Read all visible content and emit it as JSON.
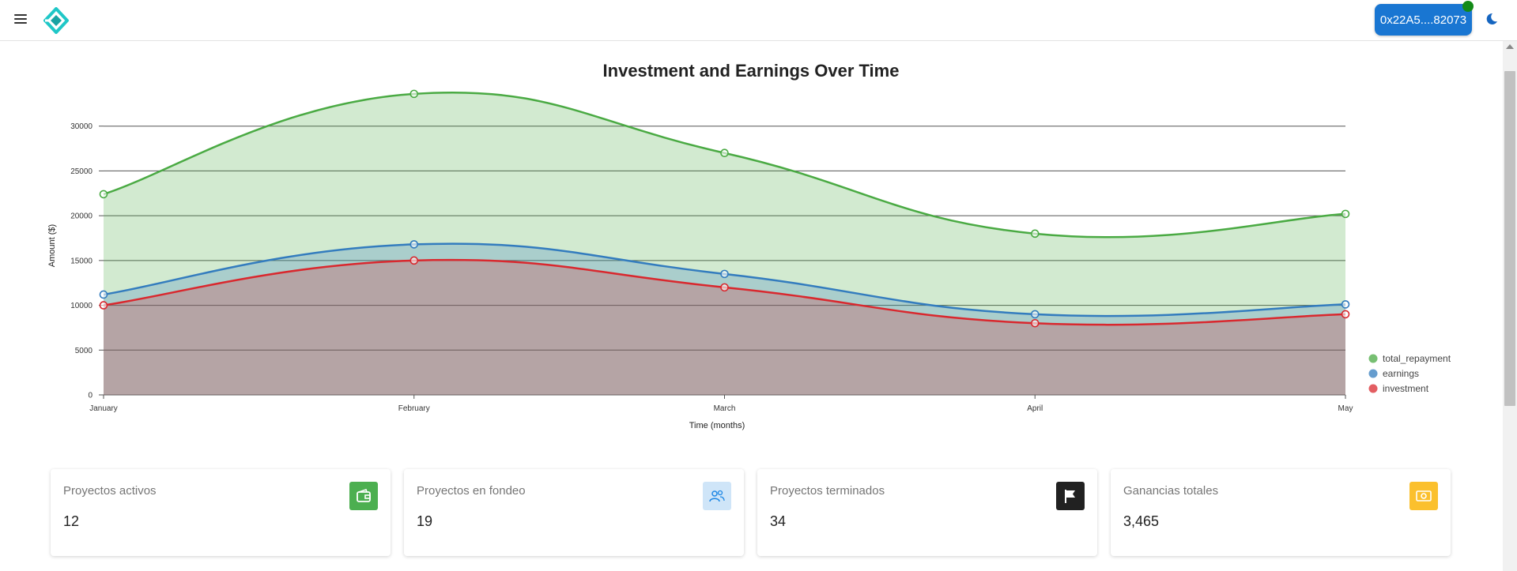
{
  "header": {
    "wallet_address": "0x22A5....82073"
  },
  "colors": {
    "total_repayment": "#4aaa43",
    "earnings": "#337cbe",
    "investment": "#d9282e",
    "wallet_button": "#1976d2",
    "status_dot": "#138a17"
  },
  "chart_data": {
    "type": "area",
    "title": "Investment and Earnings Over Time",
    "xlabel": "Time (months)",
    "ylabel": "Amount ($)",
    "categories": [
      "January",
      "February",
      "March",
      "April",
      "May"
    ],
    "ylim": [
      0,
      33500
    ],
    "y_ticks": [
      0,
      5000,
      10000,
      15000,
      20000,
      25000,
      30000
    ],
    "grid": "horizontal",
    "legend_position": "right",
    "series": [
      {
        "name": "total_repayment",
        "values": [
          22400,
          33600,
          27000,
          18000,
          20200
        ]
      },
      {
        "name": "earnings",
        "values": [
          11200,
          16800,
          13500,
          9000,
          10100
        ]
      },
      {
        "name": "investment",
        "values": [
          10000,
          15000,
          12000,
          8000,
          9000
        ]
      }
    ]
  },
  "cards": [
    {
      "label": "Proyectos activos",
      "value": "12",
      "icon": "wallet-icon",
      "color": "#4caf50"
    },
    {
      "label": "Proyectos en fondeo",
      "value": "19",
      "icon": "people-icon",
      "color": "#cfe5f8"
    },
    {
      "label": "Proyectos terminados",
      "value": "34",
      "icon": "flag-icon",
      "color": "#212121"
    },
    {
      "label": "Ganancias totales",
      "value": "3,465",
      "icon": "money-icon",
      "color": "#fbc02d"
    }
  ]
}
